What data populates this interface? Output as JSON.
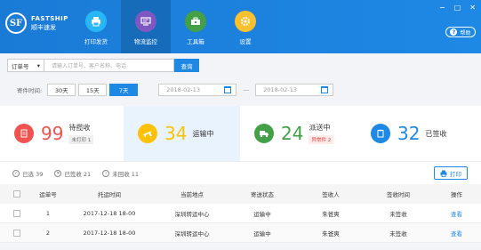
{
  "brand": {
    "en": "FASTSHIP",
    "cn": "顺丰速发",
    "mark": "SF"
  },
  "nav": [
    {
      "label": "打印发货",
      "icon": "printer-icon",
      "color": "#29b6f6"
    },
    {
      "label": "物流监控",
      "icon": "monitor-icon",
      "color": "#7e57c2"
    },
    {
      "label": "工具箱",
      "icon": "toolbox-icon",
      "color": "#43a047"
    },
    {
      "label": "设置",
      "icon": "gear-icon",
      "color": "#fbc02d"
    }
  ],
  "window": {
    "min": "−",
    "max": "□",
    "close": "✕"
  },
  "help": {
    "q": "?",
    "label": "帮助"
  },
  "search": {
    "select": "订单号",
    "placeholder": "请输入订单号、客户名称、电话",
    "button": "查询"
  },
  "date": {
    "label": "寄件时间:",
    "ranges": [
      "30天",
      "15天",
      "7天"
    ],
    "start": "2018-02-13",
    "sep": "—",
    "end": "2018-02-13"
  },
  "stats": [
    {
      "num": "99",
      "label": "待揽收",
      "sub": "未打印 1",
      "color": "#ef5350",
      "icon": "document-icon"
    },
    {
      "num": "34",
      "label": "运输中",
      "sub": "",
      "color": "#ffc107",
      "icon": "plane-icon"
    },
    {
      "num": "24",
      "label": "派送中",
      "sub": "异常件 2",
      "color": "#43a047",
      "icon": "truck-icon"
    },
    {
      "num": "32",
      "label": "已签收",
      "sub": "",
      "color": "#1e88e5",
      "icon": "clipboard-icon"
    }
  ],
  "filters": [
    {
      "label": "已选 39",
      "icon": "check-circle-icon"
    },
    {
      "label": "已签收 21",
      "icon": "cross-circle-icon"
    },
    {
      "label": "未回收 11",
      "icon": "arrow-circle-icon"
    }
  ],
  "print_label": "打印",
  "table": {
    "headers": [
      "运单号",
      "托运时间",
      "当前地点",
      "寄送状态",
      "签收人",
      "签收时间",
      "操作"
    ],
    "rows": [
      [
        "1",
        "2017-12-18  18-00",
        "深圳转运中心",
        "运输中",
        "朱爸爽",
        "未签收",
        "查看"
      ],
      [
        "2",
        "2017-12-18  18-00",
        "深圳转运中心",
        "运输中",
        "朱爸爽",
        "未签收",
        "查看"
      ]
    ]
  }
}
